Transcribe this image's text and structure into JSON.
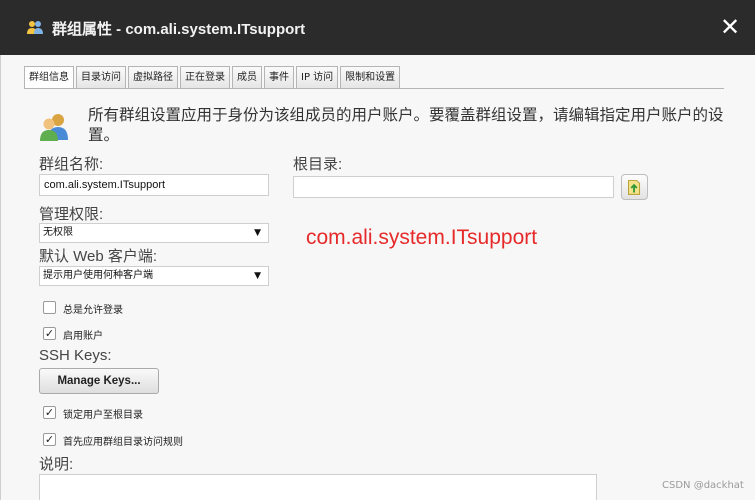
{
  "window": {
    "title": "群组属性 - com.ali.system.ITsupport",
    "close_label": "✕"
  },
  "tabs": [
    {
      "label": "群组信息",
      "active": true
    },
    {
      "label": "目录访问"
    },
    {
      "label": "虚拟路径"
    },
    {
      "label": "正在登录"
    },
    {
      "label": "成员"
    },
    {
      "label": "事件"
    },
    {
      "label": "IP 访问"
    },
    {
      "label": "限制和设置"
    }
  ],
  "description": "所有群组设置应用于身份为该组成员的用户账户。要覆盖群组设置，请编辑指定用户账户的设置。",
  "fields": {
    "group_name_label": "群组名称:",
    "group_name_value": "com.ali.system.ITsupport",
    "root_dir_label": "根目录:",
    "root_dir_value": "",
    "admin_rights_label": "管理权限:",
    "admin_rights_value": "无权限",
    "default_web_client_label": "默认 Web 客户端:",
    "default_web_client_value": "提示用户使用何种客户端"
  },
  "overlay_text": "com.ali.system.ITsupport",
  "checkboxes": [
    {
      "label": "总是允许登录",
      "checked": false
    },
    {
      "label": "启用账户",
      "checked": true
    }
  ],
  "ssh": {
    "label": "SSH Keys:",
    "button_label": "Manage Keys..."
  },
  "checkboxes2": [
    {
      "label": "锁定用户至根目录",
      "checked": true
    },
    {
      "label": "首先应用群组目录访问规则",
      "checked": true
    }
  ],
  "notes_label": "说明:",
  "watermark": "CSDN @dackhat",
  "icons": {
    "title": "group-icon",
    "browse": "folder-browse-icon",
    "description": "users-icon"
  }
}
